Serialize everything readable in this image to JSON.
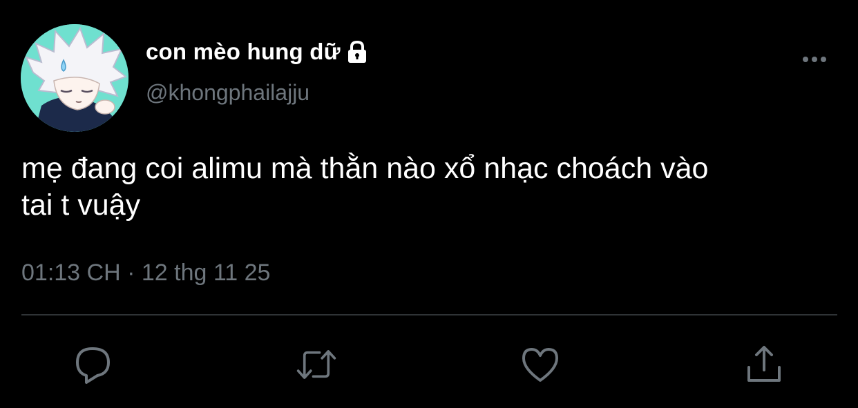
{
  "tweet": {
    "display_name": "con mèo hung dữ",
    "handle": "@khongphailajju",
    "text": "mẹ đang coi alimu mà thằn nào xổ nhạc choách vào\ntai t vuậy",
    "timestamp": "01:13 CH",
    "separator": "·",
    "date": "12 thg 11 25"
  },
  "icons": {
    "lock": "lock-icon",
    "more": "more-icon",
    "reply": "reply-icon",
    "retweet": "retweet-icon",
    "like": "heart-icon",
    "share": "share-icon"
  },
  "colors": {
    "background": "#000000",
    "primary_text": "#ffffff",
    "secondary_text": "#6e767d",
    "divider": "#2f3336",
    "avatar_bg": "#6fe0cf"
  }
}
